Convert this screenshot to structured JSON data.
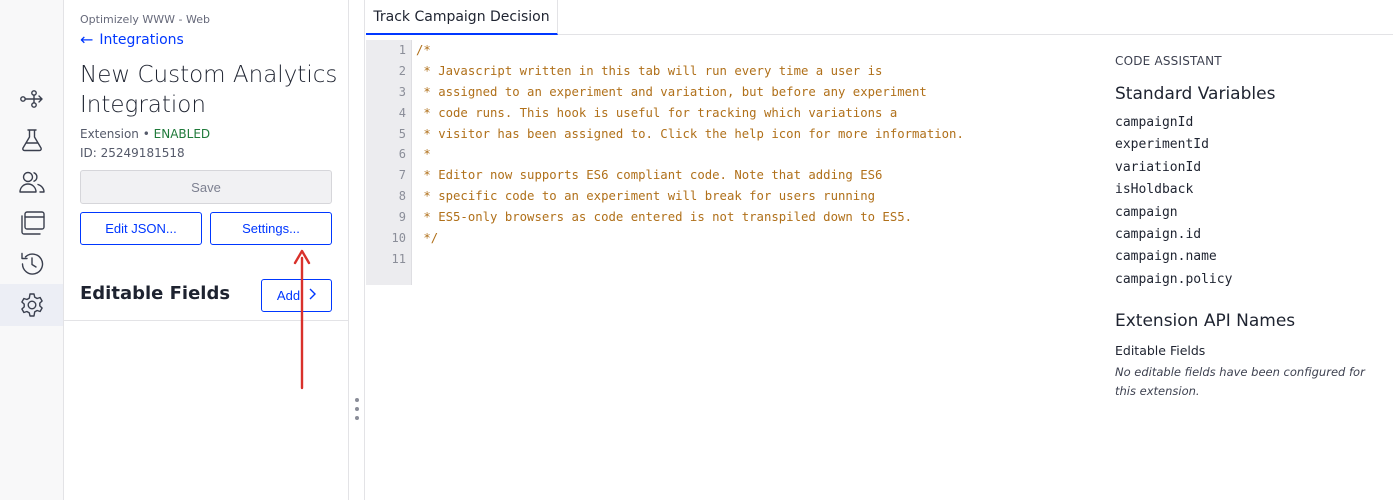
{
  "rail": {
    "items": [
      {
        "name": "flow-icon"
      },
      {
        "name": "flask-icon"
      },
      {
        "name": "users-icon"
      },
      {
        "name": "windows-icon"
      },
      {
        "name": "history-icon"
      },
      {
        "name": "gear-icon",
        "active": true
      }
    ]
  },
  "sidebar": {
    "project": "Optimizely WWW - Web",
    "back_label": "Integrations",
    "title": "New Custom Analytics Integration",
    "type": "Extension",
    "bullet": " • ",
    "status": "ENABLED",
    "id_text": "ID: 25249181518",
    "save_label": "Save",
    "edit_json_label": "Edit JSON...",
    "settings_label": "Settings...",
    "editable_fields_title": "Editable Fields",
    "add_label": "Add"
  },
  "tabs": [
    {
      "label": "Track Campaign Decision",
      "active": true
    }
  ],
  "editor": {
    "line_numbers": [
      "1",
      "2",
      "3",
      "4",
      "5",
      "6",
      "7",
      "8",
      "9",
      "10",
      "11"
    ],
    "lines": [
      "/*",
      " * Javascript written in this tab will run every time a user is",
      " * assigned to an experiment and variation, but before any experiment",
      " * code runs. This hook is useful for tracking which variations a",
      " * visitor has been assigned to. Click the help icon for more information.",
      " *",
      " * Editor now supports ES6 compliant code. Note that adding ES6",
      " * specific code to an experiment will break for users running",
      " * ES5-only browsers as code entered is not transpiled down to ES5.",
      " */",
      ""
    ]
  },
  "assistant": {
    "label": "CODE ASSISTANT",
    "standard_title": "Standard Variables",
    "variables": [
      "campaignId",
      "experimentId",
      "variationId",
      "isHoldback",
      "campaign",
      "campaign.id",
      "campaign.name",
      "campaign.policy"
    ],
    "api_title": "Extension API Names",
    "api_subtitle": "Editable Fields",
    "api_note": "No editable fields have been configured for this extension."
  },
  "colors": {
    "accent": "#0037ff",
    "status_enabled": "#1f7a3a",
    "code_comment": "#b0701a",
    "annotation_arrow": "#d9312b"
  }
}
